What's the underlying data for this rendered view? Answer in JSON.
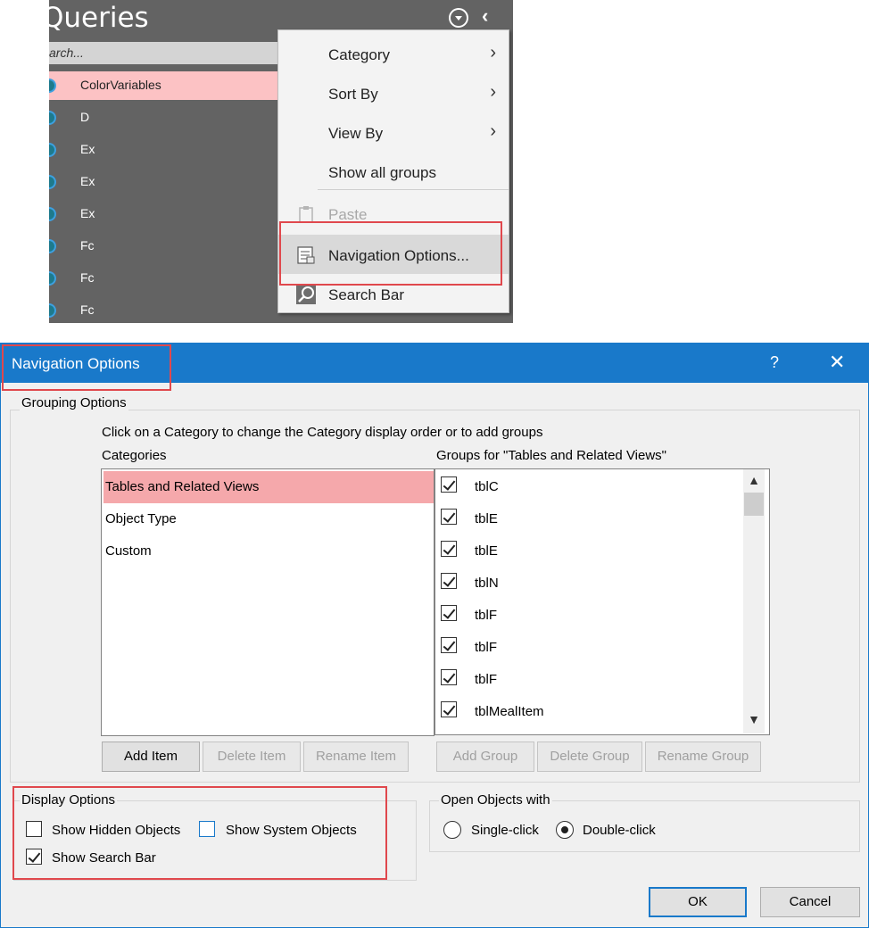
{
  "nav_pane": {
    "title": "Queries",
    "search_placeholder": "arch...",
    "items": [
      {
        "label": "ColorVariables",
        "selected": true
      },
      {
        "label": "D"
      },
      {
        "label": "Ex"
      },
      {
        "label": "Ex"
      },
      {
        "label": "Ex"
      },
      {
        "label": "Fc"
      },
      {
        "label": "Fc"
      },
      {
        "label": "Fc"
      }
    ],
    "menu_icon": "chevron-down-circle-icon",
    "collapse_icon": "chevron-left-icon"
  },
  "context_menu": {
    "items": [
      {
        "label": "Category",
        "submenu": true
      },
      {
        "label": "Sort By",
        "submenu": true
      },
      {
        "label": "View By",
        "submenu": true
      },
      {
        "label": "Show all groups"
      },
      {
        "label": "Paste",
        "disabled": true,
        "icon": "clipboard-icon"
      },
      {
        "label": "Navigation Options...",
        "highlighted": true,
        "icon": "navigation-options-icon"
      },
      {
        "label": "Search Bar",
        "icon": "magnifier-icon"
      }
    ]
  },
  "dialog": {
    "title": "Navigation Options",
    "help": "?",
    "close": "✕",
    "grouping_options": {
      "label": "Grouping Options",
      "instruction": "Click on a Category to change the Category display order or to add groups",
      "categories_label": "Categories",
      "categories": [
        "Tables and Related Views",
        "Object Type",
        "Custom"
      ],
      "groups_label": "Groups for \"Tables and Related Views\"",
      "groups": [
        {
          "label": "tblC",
          "checked": true
        },
        {
          "label": "tblE",
          "checked": true
        },
        {
          "label": "tblE",
          "checked": true
        },
        {
          "label": "tblN",
          "checked": true
        },
        {
          "label": "tblF",
          "checked": true
        },
        {
          "label": "tblF",
          "checked": true
        },
        {
          "label": "tblF",
          "checked": true
        },
        {
          "label": "tblMealItem",
          "checked": true
        }
      ],
      "buttons": {
        "add_item": "Add Item",
        "delete_item": "Delete Item",
        "rename_item": "Rename Item",
        "add_group": "Add Group",
        "delete_group": "Delete Group",
        "rename_group": "Rename Group"
      }
    },
    "display_options": {
      "label": "Display Options",
      "show_hidden": {
        "label": "Show Hidden Objects",
        "checked": false
      },
      "show_system": {
        "label": "Show System Objects",
        "checked": false
      },
      "show_search": {
        "label": "Show Search Bar",
        "checked": true
      }
    },
    "open_objects": {
      "label": "Open Objects with",
      "single_click": {
        "label": "Single-click",
        "selected": false
      },
      "double_click": {
        "label": "Double-click",
        "selected": true
      }
    },
    "ok": "OK",
    "cancel": "Cancel"
  },
  "colors": {
    "titlebar": "#1979ca",
    "highlight_red": "#e0484d",
    "selection_pink": "#f5a8ab",
    "nav_background": "#636363"
  }
}
